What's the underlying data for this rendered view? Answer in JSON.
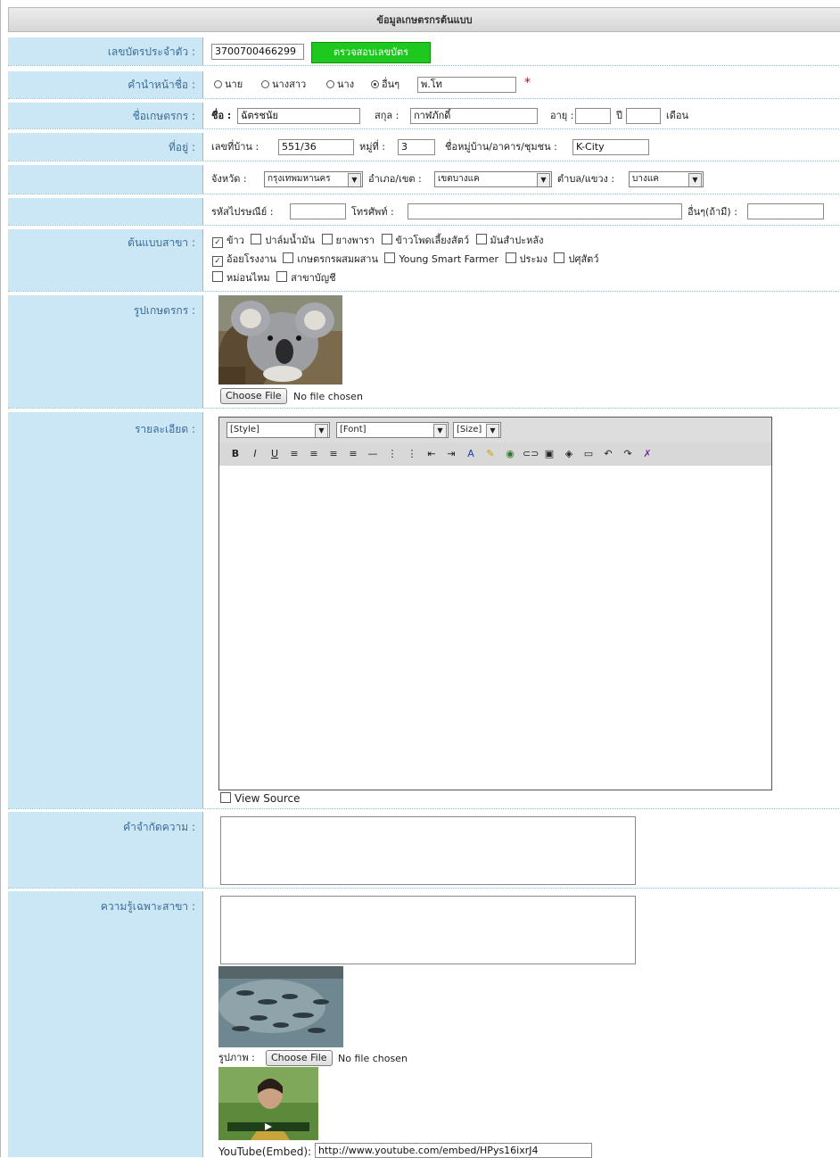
{
  "title": "ข้อมูลเกษตรกรต้นแบบ",
  "id_card": {
    "label": "เลขบัตรประจำตัว :",
    "value": "3700700466299",
    "check_button": "ตรวจสอบเลขบัตร"
  },
  "prefix": {
    "label": "คำนำหน้าชื่อ :",
    "options": [
      "นาย",
      "นางสาว",
      "นาง",
      "อื่นๆ"
    ],
    "selected": "อื่นๆ",
    "other_value": "พ.โท",
    "required": "*"
  },
  "farmer": {
    "label": "ชื่อเกษตรกร :",
    "first_label": "ชื่อ :",
    "first_value": "ฉัตรชนัย",
    "last_label": "สกุล :",
    "last_value": "กาฬภักดิ์",
    "age_label": "อายุ :",
    "age_years": "",
    "years_label": "ปี",
    "age_months": "",
    "months_label": "เดือน"
  },
  "address": {
    "label": "ที่อยู่ :",
    "house_label": "เลขที่บ้าน :",
    "house_value": "551/36",
    "moo_label": "หมู่ที่ :",
    "moo_value": "3",
    "village_label": "ชื่อหมู่บ้าน/อาคาร/ชุมชน :",
    "village_value": "K-City",
    "province_label": "จังหวัด :",
    "province_value": "กรุงเทพมหานคร",
    "district_label": "อำเภอ/เขต :",
    "district_value": "เขตบางแค",
    "subdistrict_label": "ตำบล/แขวง :",
    "subdistrict_value": "บางแค",
    "postal_label": "รหัสไปรษณีย์ :",
    "postal_value": "",
    "phone_label": "โทรศัพท์ :",
    "phone_value": "",
    "other_label": "อื่นๆ(ถ้ามี) :",
    "other_value": ""
  },
  "branch": {
    "label": "ต้นแบบสาขา :",
    "items": [
      {
        "name": "ข้าว",
        "checked": true
      },
      {
        "name": "ปาล์มน้ำมัน",
        "checked": false
      },
      {
        "name": "ยางพารา",
        "checked": false
      },
      {
        "name": "ข้าวโพดเลี้ยงสัตว์",
        "checked": false
      },
      {
        "name": "มันสำปะหลัง",
        "checked": false
      },
      {
        "name": "อ้อยโรงงาน",
        "checked": true
      },
      {
        "name": "เกษตรกรผสมผสาน",
        "checked": false
      },
      {
        "name": "Young Smart Farmer",
        "checked": false
      },
      {
        "name": "ประมง",
        "checked": false
      },
      {
        "name": "ปศุสัตว์",
        "checked": false
      },
      {
        "name": "หม่อนไหม",
        "checked": false
      },
      {
        "name": "สาขาบัญชี",
        "checked": false
      }
    ]
  },
  "photo": {
    "label": "รูปเกษตรกร :",
    "choose_file": "Choose File",
    "no_file": "No file chosen"
  },
  "detail": {
    "label": "รายละเอียด :",
    "style": "[Style]",
    "font": "[Font]",
    "size": "[Size]",
    "view_source": "View Source",
    "toolbar_icons": [
      "bold-icon",
      "italic-icon",
      "underline-icon",
      "align-left-icon",
      "align-center-icon",
      "align-right-icon",
      "align-justify-icon",
      "horizontal-rule-icon",
      "ordered-list-icon",
      "unordered-list-icon",
      "outdent-icon",
      "indent-icon",
      "font-color-icon",
      "highlight-icon",
      "web-icon",
      "link-icon",
      "image-icon",
      "table-icon",
      "box-icon",
      "undo-icon",
      "redo-icon",
      "remove-format-icon"
    ],
    "toolbar_glyphs": [
      "B",
      "I",
      "U",
      "≡",
      "≡",
      "≡",
      "≡",
      "—",
      "⋮",
      "⋮",
      "⇤",
      "⇥",
      "A",
      "✎",
      "◉",
      "⊂⊃",
      "▣",
      "◈",
      "▭",
      "↶",
      "↷",
      "✗"
    ]
  },
  "tagline": {
    "label": "คำจำกัดความ :"
  },
  "knowledge": {
    "label": "ความรู้เฉพาะสาขา :",
    "image_label": "รูปภาพ :",
    "choose_file": "Choose File",
    "no_file": "No file chosen",
    "youtube_label": "YouTube(Embed):",
    "youtube_value": "http://www.youtube.com/embed/HPys16ixrJ4"
  }
}
